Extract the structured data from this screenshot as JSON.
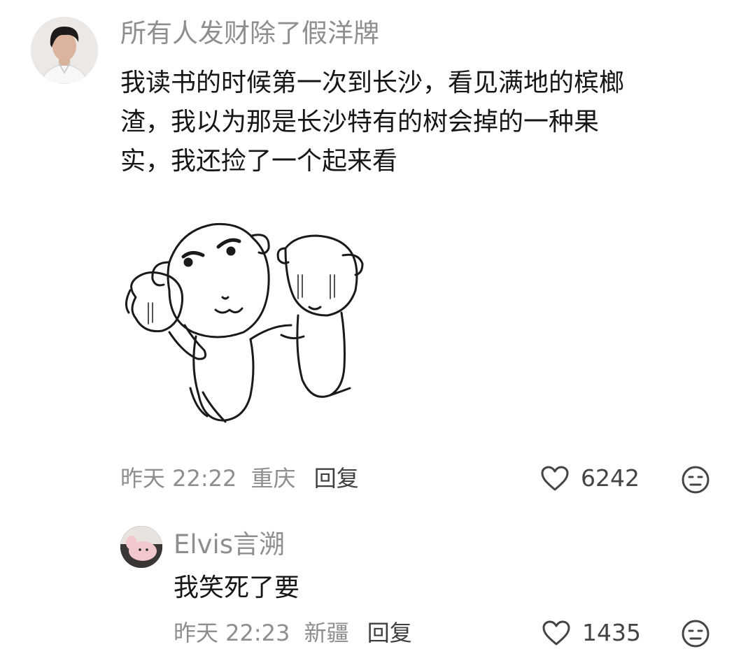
{
  "comment": {
    "username": "所有人发财除了假洋牌",
    "content_lines": [
      "我读书的时候第一次到长沙，看见满地的槟榔",
      "渣，我以为那是长沙特有的树会掉的一种果",
      "实，我还捡了一个起来看"
    ],
    "time": "昨天 22:22",
    "location": "重庆",
    "reply_label": "回复",
    "like_count": "6242"
  },
  "reply": {
    "username": "Elvis言溯",
    "content": "我笑死了要",
    "time": "昨天 22:23",
    "location": "新疆",
    "reply_label": "回复",
    "like_count": "1435"
  },
  "icons": [
    "heart-icon",
    "dislike-face-icon"
  ],
  "colors": {
    "text": "#161616",
    "muted": "#8e8e8e",
    "reply_link": "#3f3f3f",
    "background": "#ffffff"
  }
}
